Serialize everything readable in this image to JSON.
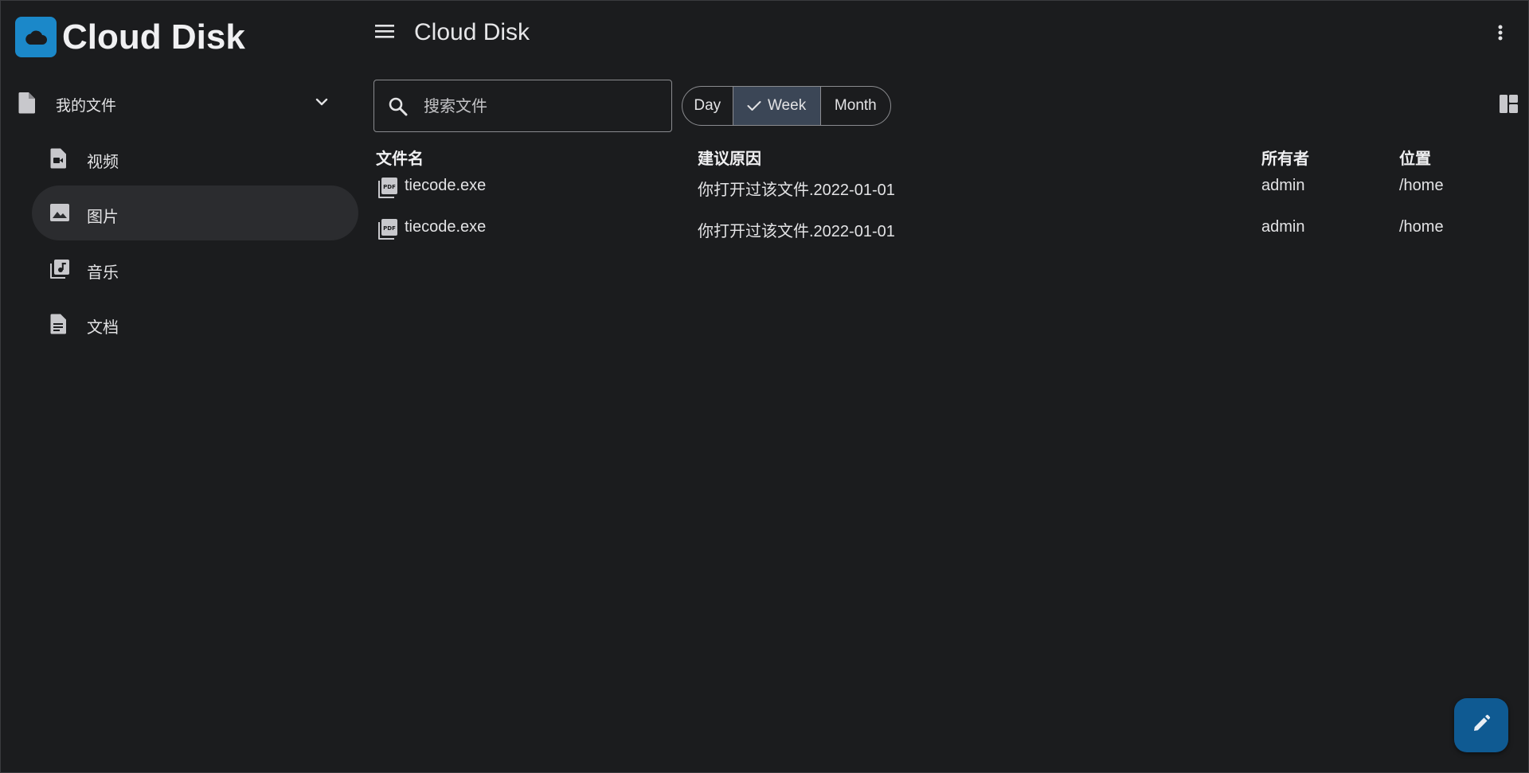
{
  "app": {
    "name": "Cloud Disk",
    "logo_icon": "cloud-icon",
    "brand_color": "#1b88c9"
  },
  "topbar": {
    "title": "Cloud Disk",
    "menu_icon": "menu-icon",
    "more_icon": "more-vert-icon"
  },
  "sidebar": {
    "root": {
      "label": "我的文件",
      "icon": "file-icon",
      "expanded": true
    },
    "items": [
      {
        "label": "视频",
        "icon": "video-file-icon",
        "active": false
      },
      {
        "label": "图片",
        "icon": "image-icon",
        "active": true
      },
      {
        "label": "音乐",
        "icon": "music-library-icon",
        "active": false
      },
      {
        "label": "文档",
        "icon": "document-icon",
        "active": false
      }
    ]
  },
  "search": {
    "placeholder": "搜索文件",
    "value": ""
  },
  "range": {
    "options": [
      "Day",
      "Week",
      "Month"
    ],
    "selected": "Week"
  },
  "table": {
    "headers": {
      "name": "文件名",
      "reason": "建议原因",
      "owner": "所有者",
      "location": "位置"
    },
    "rows": [
      {
        "name": "tiecode.exe",
        "reason": "你打开过该文件.2022-01-01",
        "owner": "admin",
        "location": "/home",
        "icon": "pdf-icon"
      },
      {
        "name": "tiecode.exe",
        "reason": "你打开过该文件.2022-01-01",
        "owner": "admin",
        "location": "/home",
        "icon": "pdf-icon"
      }
    ]
  },
  "fab": {
    "icon": "edit-icon",
    "color": "#0f5a92"
  }
}
